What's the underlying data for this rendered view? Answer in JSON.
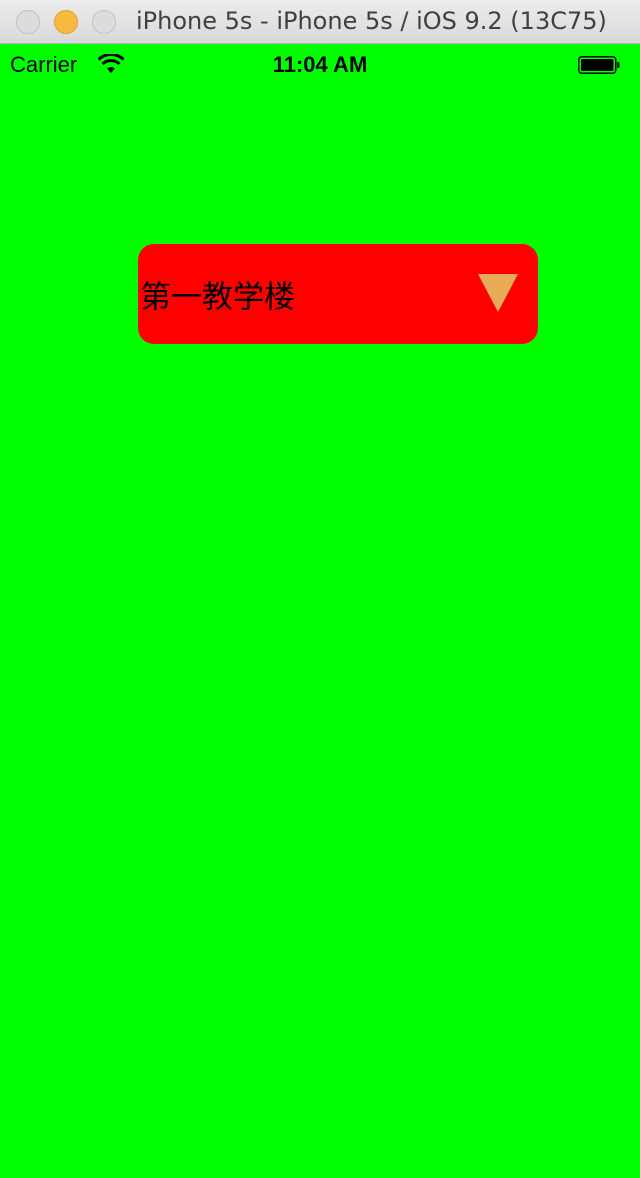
{
  "window": {
    "title": "iPhone 5s - iPhone 5s / iOS 9.2 (13C75)"
  },
  "status_bar": {
    "carrier": "Carrier",
    "time": "11:04 AM",
    "icons": [
      "wifi-icon",
      "battery-icon"
    ]
  },
  "dropdown": {
    "selected_value": "第一教学楼",
    "icon": "triangle-down-icon"
  },
  "colors": {
    "background": "#00ff00",
    "dropdown_background": "#ff0000",
    "arrow": "#e8ac58"
  }
}
